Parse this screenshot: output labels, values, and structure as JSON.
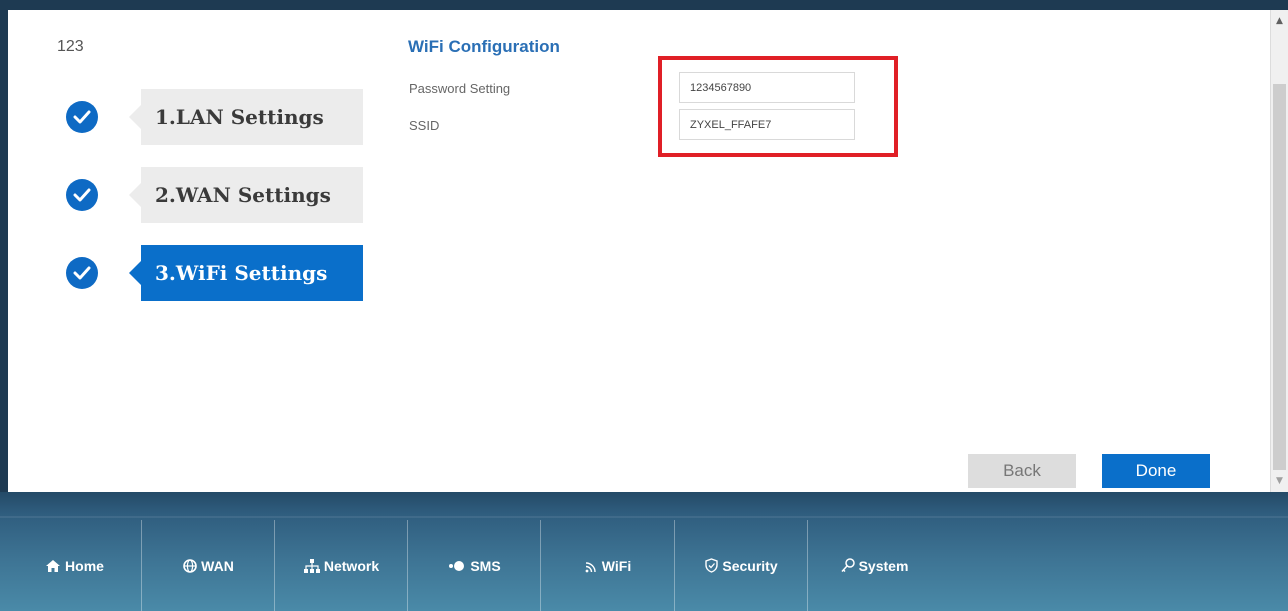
{
  "wizard": {
    "step_counter": "123",
    "steps": [
      {
        "label": "1.LAN Settings",
        "state": "done"
      },
      {
        "label": "2.WAN Settings",
        "state": "done"
      },
      {
        "label": "3.WiFi Settings",
        "state": "active"
      }
    ]
  },
  "wifi_config": {
    "title": "WiFi Configuration",
    "password_label": "Password Setting",
    "password_value": "1234567890",
    "ssid_label": "SSID",
    "ssid_value": "ZYXEL_FFAFE7"
  },
  "buttons": {
    "back": "Back",
    "done": "Done"
  },
  "nav": {
    "items": [
      {
        "label": "Home",
        "icon": "home-icon"
      },
      {
        "label": "WAN",
        "icon": "globe-icon"
      },
      {
        "label": "Network",
        "icon": "network-icon"
      },
      {
        "label": "SMS",
        "icon": "chat-icon"
      },
      {
        "label": "WiFi",
        "icon": "wifi-icon"
      },
      {
        "label": "Security",
        "icon": "shield-icon"
      },
      {
        "label": "System",
        "icon": "key-icon"
      }
    ]
  },
  "colors": {
    "accent": "#0a6fca",
    "highlight": "#e01f26",
    "navbar": "#3d7393",
    "step_inactive": "#ececec"
  }
}
